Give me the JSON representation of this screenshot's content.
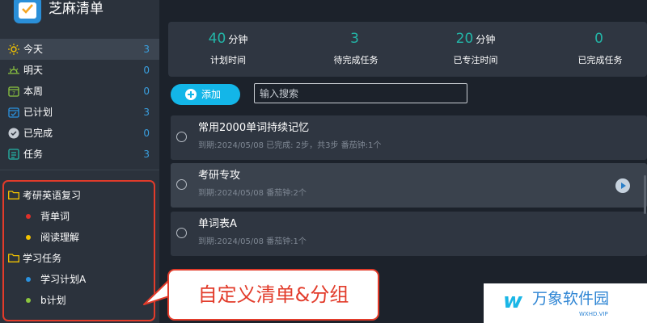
{
  "app": {
    "title": "芝麻清单"
  },
  "nav": [
    {
      "label": "今天",
      "count": "3",
      "icon": "sun-icon",
      "active": true
    },
    {
      "label": "明天",
      "count": "0",
      "icon": "sunrise-icon"
    },
    {
      "label": "本周",
      "count": "0",
      "icon": "calendar-week-icon"
    },
    {
      "label": "已计划",
      "count": "3",
      "icon": "calendar-check-icon"
    },
    {
      "label": "已完成",
      "count": "0",
      "icon": "check-circle-icon"
    },
    {
      "label": "任务",
      "count": "3",
      "icon": "task-list-icon"
    }
  ],
  "groups": [
    {
      "label": "考研英语复习",
      "lists": [
        {
          "label": "背单词",
          "color": "#e0302a"
        },
        {
          "label": "阅读理解",
          "color": "#f2c200"
        }
      ]
    },
    {
      "label": "学习任务",
      "lists": [
        {
          "label": "学习计划A",
          "color": "#2a92e0"
        },
        {
          "label": "b计划",
          "color": "#8cc63f"
        }
      ]
    }
  ],
  "stats": [
    {
      "value": "40",
      "unit": "分钟",
      "label": "计划时间"
    },
    {
      "value": "3",
      "unit": "",
      "label": "待完成任务"
    },
    {
      "value": "20",
      "unit": "分钟",
      "label": "已专注时间"
    },
    {
      "value": "0",
      "unit": "",
      "label": "已完成任务"
    }
  ],
  "toolbar": {
    "add_label": "添加",
    "search_placeholder": "输入搜索"
  },
  "tasks": [
    {
      "title": "常用2000单词持续记忆",
      "meta": "到期:2024/05/08 已完成: 2步，共3步 番茄钟:1个"
    },
    {
      "title": "考研专攻",
      "meta": "到期:2024/05/08 番茄钟:2个"
    },
    {
      "title": "单词表A",
      "meta": "到期:2024/05/08 番茄钟:1个"
    }
  ],
  "callout": {
    "text": "自定义清单&分组"
  },
  "watermark": {
    "text": "万象软件园",
    "sub": "WXHD.VIP"
  },
  "colors": {
    "accent": "#13b6e8",
    "stat": "#23b6a8",
    "annotation": "#e23b2a",
    "count": "#3aa0e0"
  }
}
